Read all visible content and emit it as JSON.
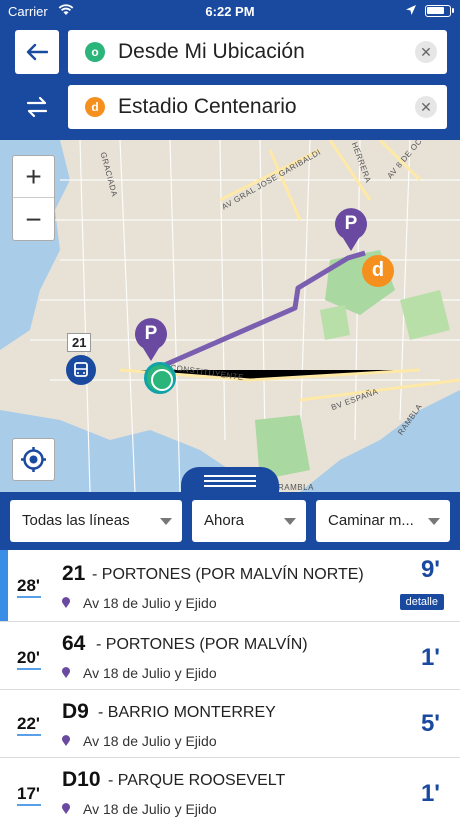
{
  "status_bar": {
    "carrier": "Carrier",
    "time": "6:22 PM"
  },
  "search": {
    "origin": {
      "badge": "o",
      "text": "Desde Mi Ubicación"
    },
    "destination": {
      "badge": "d",
      "text": "Estadio Centenario"
    }
  },
  "map": {
    "labels": {
      "graciada": "GRACIADA",
      "garibaldi": "AV GRAL JOSE GARIBALDI",
      "herrera": "HERRERA",
      "av8oc": "AV 8 DE OC",
      "constituyente": "CONSTITUYENTE",
      "espana": "BV ESPAÑA",
      "rambla": "RAMBLA",
      "rambla2": "RAMBLA"
    },
    "markers": {
      "parking": "P",
      "destination": "d",
      "bus_line": "21"
    },
    "zoom_in": "+",
    "zoom_out": "−"
  },
  "filters": {
    "lines": "Todas las líneas",
    "time": "Ahora",
    "mode": "Caminar m..."
  },
  "results": [
    {
      "freq": "28'",
      "line": "21",
      "dest": "- PORTONES (POR MALVÍN NORTE)",
      "stop": "Av 18 de Julio y Ejido",
      "eta": "9'",
      "detail": "detalle"
    },
    {
      "freq": "20'",
      "line": "64",
      "dest": "- PORTONES (POR MALVÍN)",
      "stop": "Av 18 de Julio y Ejido",
      "eta": "1'"
    },
    {
      "freq": "22'",
      "line": "D9",
      "dest": "- BARRIO MONTERREY",
      "stop": "Av 18 de Julio y Ejido",
      "eta": "5'"
    },
    {
      "freq": "17'",
      "line": "D10",
      "dest": "- PARQUE ROOSEVELT",
      "stop": "Av 18 de Julio y Ejido",
      "eta": "1'"
    }
  ],
  "colors": {
    "primary": "#1a4aa0",
    "origin": "#2bb57a",
    "destination": "#f5901e",
    "parking": "#6a4aa0",
    "route": "#7a5fb0"
  }
}
